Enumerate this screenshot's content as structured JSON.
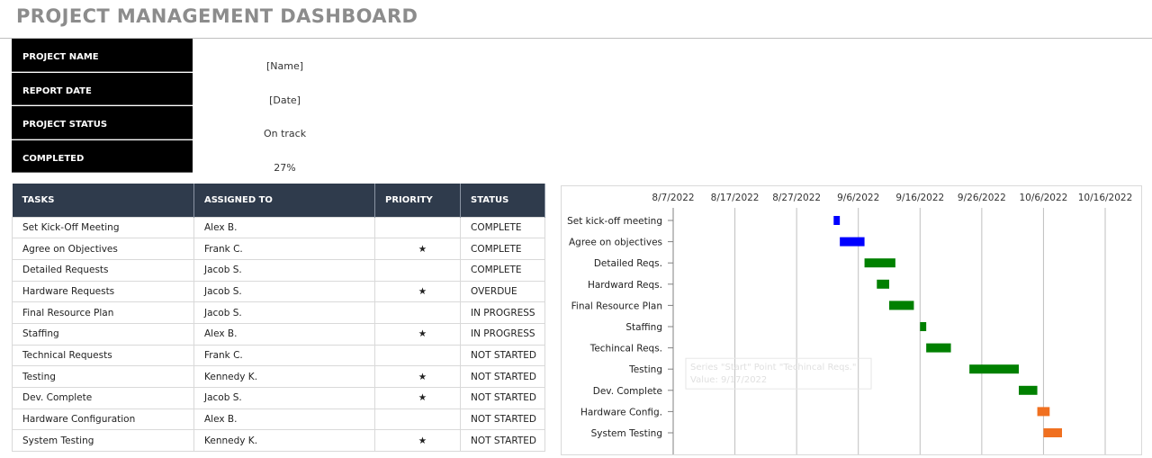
{
  "page": {
    "title": "PROJECT MANAGEMENT DASHBOARD"
  },
  "info": [
    {
      "label": "PROJECT NAME",
      "value": "[Name]"
    },
    {
      "label": "REPORT DATE",
      "value": "[Date]"
    },
    {
      "label": "PROJECT STATUS",
      "value": "On track"
    },
    {
      "label": "COMPLETED",
      "value": "27%"
    }
  ],
  "table": {
    "headers": [
      "TASKS",
      "ASSIGNED TO",
      "PRIORITY",
      "STATUS"
    ],
    "rows": [
      {
        "task": "Set Kick-Off Meeting",
        "assigned": "Alex B.",
        "priority": "",
        "status": "COMPLETE",
        "status_class": "st-complete"
      },
      {
        "task": "Agree on Objectives",
        "assigned": "Frank C.",
        "priority": "★",
        "status": "COMPLETE",
        "status_class": "st-complete"
      },
      {
        "task": "Detailed Requests",
        "assigned": "Jacob S.",
        "priority": "",
        "status": "COMPLETE",
        "status_class": "st-complete"
      },
      {
        "task": "Hardware Requests",
        "assigned": "Jacob S.",
        "priority": "★",
        "status": "OVERDUE",
        "status_class": "st-overdue"
      },
      {
        "task": "Final Resource Plan",
        "assigned": "Jacob S.",
        "priority": "",
        "status": "IN PROGRESS",
        "status_class": "st-progress"
      },
      {
        "task": "Staffing",
        "assigned": "Alex B.",
        "priority": "★",
        "status": "IN PROGRESS",
        "status_class": "st-progress"
      },
      {
        "task": "Technical Requests",
        "assigned": "Frank C.",
        "priority": "",
        "status": "NOT STARTED",
        "status_class": "st-not"
      },
      {
        "task": "Testing",
        "assigned": "Kennedy K.",
        "priority": "★",
        "status": "NOT STARTED",
        "status_class": "st-not"
      },
      {
        "task": "Dev. Complete",
        "assigned": "Jacob S.",
        "priority": "★",
        "status": "NOT STARTED",
        "status_class": "st-not"
      },
      {
        "task": "Hardware Configuration",
        "assigned": "Alex B.",
        "priority": "",
        "status": "NOT STARTED",
        "status_class": "st-not"
      },
      {
        "task": "System Testing",
        "assigned": "Kennedy K.",
        "priority": "★",
        "status": "NOT STARTED",
        "status_class": "st-not"
      }
    ]
  },
  "chart_data": {
    "type": "bar",
    "orientation": "horizontal-gantt",
    "x_ticks": [
      "8/7/2022",
      "8/17/2022",
      "8/27/2022",
      "9/6/2022",
      "9/16/2022",
      "9/26/2022",
      "10/6/2022",
      "10/16/2022"
    ],
    "xlim": [
      "2022-08-07",
      "2022-10-16"
    ],
    "tasks": [
      {
        "label": "Set kick-off meeting",
        "start": "2022-09-02",
        "end": "2022-09-03",
        "color": "#0000ff"
      },
      {
        "label": "Agree on objectives",
        "start": "2022-09-03",
        "end": "2022-09-07",
        "color": "#0000ff"
      },
      {
        "label": "Detailed Reqs.",
        "start": "2022-09-07",
        "end": "2022-09-12",
        "color": "#008000"
      },
      {
        "label": "Hardward Reqs.",
        "start": "2022-09-09",
        "end": "2022-09-11",
        "color": "#008000"
      },
      {
        "label": "Final Resource Plan",
        "start": "2022-09-11",
        "end": "2022-09-15",
        "color": "#008000"
      },
      {
        "label": "Staffing",
        "start": "2022-09-16",
        "end": "2022-09-17",
        "color": "#008000"
      },
      {
        "label": "Techincal Reqs.",
        "start": "2022-09-17",
        "end": "2022-09-21",
        "color": "#008000"
      },
      {
        "label": "Testing",
        "start": "2022-09-24",
        "end": "2022-10-02",
        "color": "#008000"
      },
      {
        "label": "Dev. Complete",
        "start": "2022-10-02",
        "end": "2022-10-05",
        "color": "#008000"
      },
      {
        "label": "Hardware Config.",
        "start": "2022-10-05",
        "end": "2022-10-07",
        "color": "#f07020"
      },
      {
        "label": "System Testing",
        "start": "2022-10-06",
        "end": "2022-10-09",
        "color": "#f07020"
      }
    ],
    "grid": true,
    "tooltip": {
      "line1": "Series \"Start\" Point \"Techincal Reqs.\"",
      "line2": "Value: 9/17/2022"
    }
  }
}
